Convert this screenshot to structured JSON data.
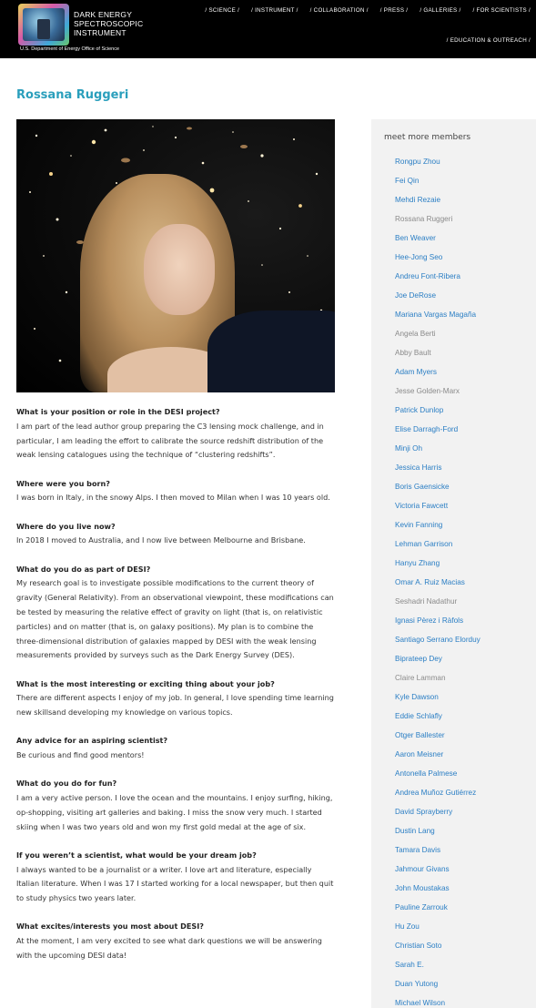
{
  "header": {
    "logo_lines": [
      "Dark Energy",
      "Spectroscopic",
      "Instrument"
    ],
    "logo_subtitle": "U.S. Department of Energy Office of Science",
    "nav_row1": [
      "/ SCIENCE /",
      "/ INSTRUMENT /",
      "/ COLLABORATION /",
      "/ PRESS /",
      "/ GALLERIES /",
      "/ FOR SCIENTISTS /"
    ],
    "nav_row2": [
      "/ EDUCATION & OUTREACH /"
    ]
  },
  "page": {
    "title": "Rossana Ruggeri"
  },
  "qa": [
    {
      "q": "What is your position or role in the DESI project?",
      "a": "I am part of the lead author group preparing the C3 lensing mock challenge, and in particular, I am leading the effort to calibrate the source redshift distribution of the weak lensing catalogues using the technique of “clustering redshifts”."
    },
    {
      "q": "Where were you born?",
      "a": "I was born in Italy, in the snowy Alps. I then moved to Milan when I was 10 years old."
    },
    {
      "q": "Where do you live now?",
      "a": "In 2018 I moved to Australia, and I now live between Melbourne and Brisbane."
    },
    {
      "q": "What do you do as part of DESI?",
      "a": "My research goal is to investigate possible modifications to the current theory of gravity (General Relativity). From an observational viewpoint, these modifications can be tested by measuring the relative effect of gravity on light (that is, on relativistic particles) and on matter (that is, on galaxy positions). My plan is to combine the three-dimensional distribution of galaxies mapped by DESI with the weak lensing measurements provided by surveys such as the Dark Energy Survey (DES)."
    },
    {
      "q": "What is the most interesting or exciting thing about your job?",
      "a": "There are different aspects I enjoy of my job. In general, I love spending time learning new skillsand developing my knowledge on various topics."
    },
    {
      "q": "Any advice for an aspiring scientist?",
      "a": "Be curious and find good mentors!"
    },
    {
      "q": "What do you do for fun?",
      "a": "I am a very active person. I love the ocean and the mountains. I enjoy surfing, hiking, op-shopping, visiting art galleries and baking. I miss the snow very much. I started skiing when I was two years old and won my first gold medal at the age of six."
    },
    {
      "q": "If you weren’t a scientist, what would be your dream job?",
      "a": "I always wanted to be a journalist or a writer. I love art and literature, especially Italian literature. When I was 17 I started working for a local newspaper, but then quit to study physics two years later."
    },
    {
      "q": "What excites/interests you most about DESI?",
      "a": "At the moment, I am very excited to see what dark questions we will be answering with the upcoming DESI data!"
    }
  ],
  "sidebar": {
    "title": "meet more members",
    "members": [
      {
        "name": "Rongpu Zhou",
        "link": true
      },
      {
        "name": "Fei Qin",
        "link": true
      },
      {
        "name": "Mehdi Rezaie",
        "link": true
      },
      {
        "name": "Rossana Ruggeri",
        "link": false
      },
      {
        "name": "Ben Weaver",
        "link": true
      },
      {
        "name": "Hee-Jong Seo",
        "link": true
      },
      {
        "name": "Andreu Font-Ribera",
        "link": true
      },
      {
        "name": "Joe DeRose",
        "link": true
      },
      {
        "name": "Mariana Vargas Magaña",
        "link": true
      },
      {
        "name": "Angela Berti",
        "link": false
      },
      {
        "name": "Abby Bault",
        "link": false
      },
      {
        "name": "Adam Myers",
        "link": true
      },
      {
        "name": "Jesse Golden-Marx",
        "link": false
      },
      {
        "name": "Patrick Dunlop",
        "link": true
      },
      {
        "name": "Elise Darragh-Ford",
        "link": true
      },
      {
        "name": "Minji Oh",
        "link": true
      },
      {
        "name": "Jessica Harris",
        "link": true
      },
      {
        "name": "Boris Gaensicke",
        "link": true
      },
      {
        "name": "Victoria Fawcett",
        "link": true
      },
      {
        "name": "Kevin Fanning",
        "link": true
      },
      {
        "name": "Lehman Garrison",
        "link": true
      },
      {
        "name": "Hanyu Zhang",
        "link": true
      },
      {
        "name": "Omar A. Ruiz Macias",
        "link": true
      },
      {
        "name": "Seshadri Nadathur",
        "link": false
      },
      {
        "name": "Ignasi Pèrez i Ràfols",
        "link": true
      },
      {
        "name": "Santiago Serrano Elorduy",
        "link": true
      },
      {
        "name": "Biprateep Dey",
        "link": true
      },
      {
        "name": "Claire Lamman",
        "link": false
      },
      {
        "name": "Kyle Dawson",
        "link": true
      },
      {
        "name": "Eddie Schlafly",
        "link": true
      },
      {
        "name": "Otger Ballester",
        "link": true
      },
      {
        "name": "Aaron Meisner",
        "link": true
      },
      {
        "name": "Antonella Palmese",
        "link": true
      },
      {
        "name": "Andrea Muñoz Gutiérrez",
        "link": true
      },
      {
        "name": "David Sprayberry",
        "link": true
      },
      {
        "name": "Dustin Lang",
        "link": true
      },
      {
        "name": "Tamara Davis",
        "link": true
      },
      {
        "name": "Jahmour Givans",
        "link": true
      },
      {
        "name": "John Moustakas",
        "link": true
      },
      {
        "name": "Pauline Zarrouk",
        "link": true
      },
      {
        "name": "Hu Zou",
        "link": true
      },
      {
        "name": "Christian Soto",
        "link": true
      },
      {
        "name": "Sarah E.",
        "link": true
      },
      {
        "name": "Duan Yutong",
        "link": true
      },
      {
        "name": "Michael Wilson",
        "link": true
      }
    ]
  }
}
